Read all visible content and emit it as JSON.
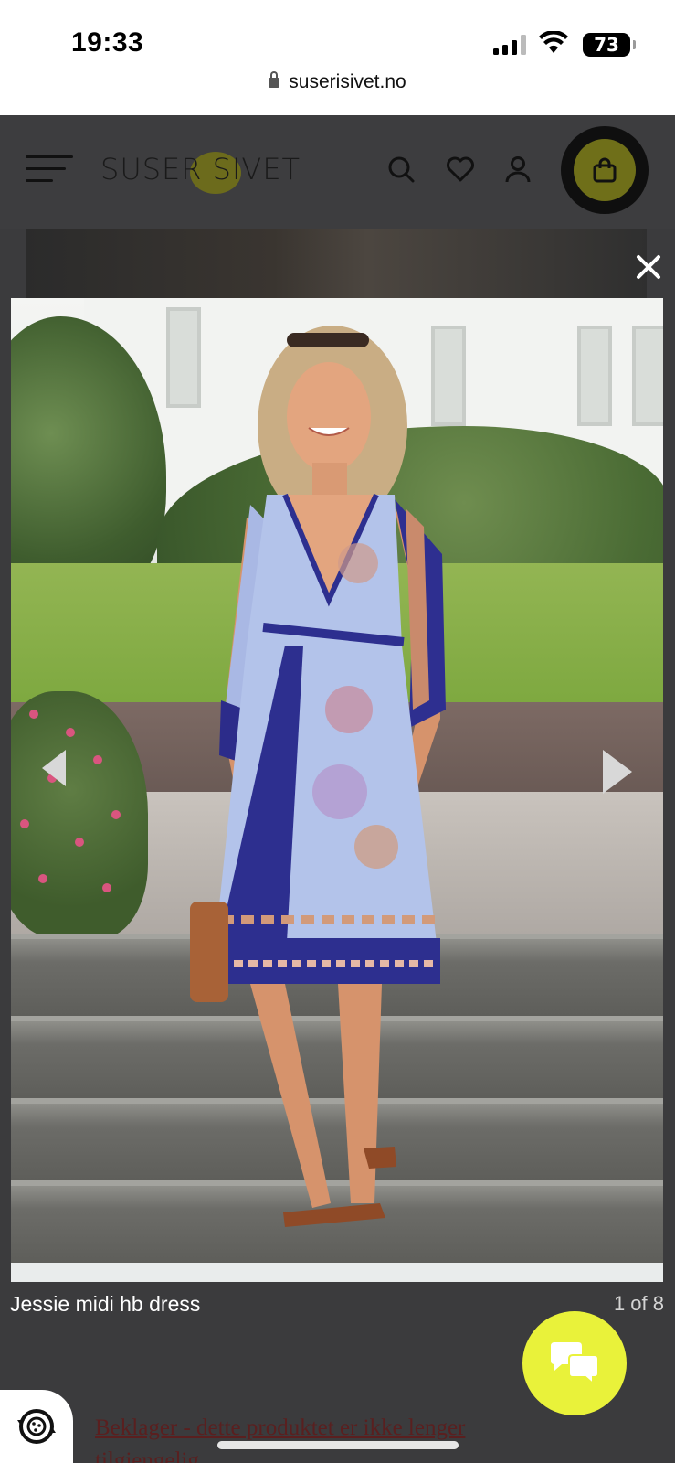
{
  "status_bar": {
    "time": "19:33",
    "battery": "73"
  },
  "browser": {
    "url": "suserisivet.no"
  },
  "header": {
    "logo_text": "SUSER SIVET"
  },
  "lightbox": {
    "caption": "Jessie midi hb dress",
    "counter": "1 of 8"
  },
  "notice": {
    "line1": "Beklager - dette produktet er ikke lenger",
    "line2": "tilgjengelig"
  },
  "colors": {
    "accent_yellow": "#e9f23a",
    "overlay": "#3b3b3d",
    "notice_text": "#5a1f1f"
  },
  "icons": [
    "menu-icon",
    "search-icon",
    "heart-icon",
    "user-icon",
    "cart-icon",
    "close-icon",
    "arrow-left-icon",
    "arrow-right-icon",
    "chat-icon",
    "cookie-settings-icon"
  ]
}
